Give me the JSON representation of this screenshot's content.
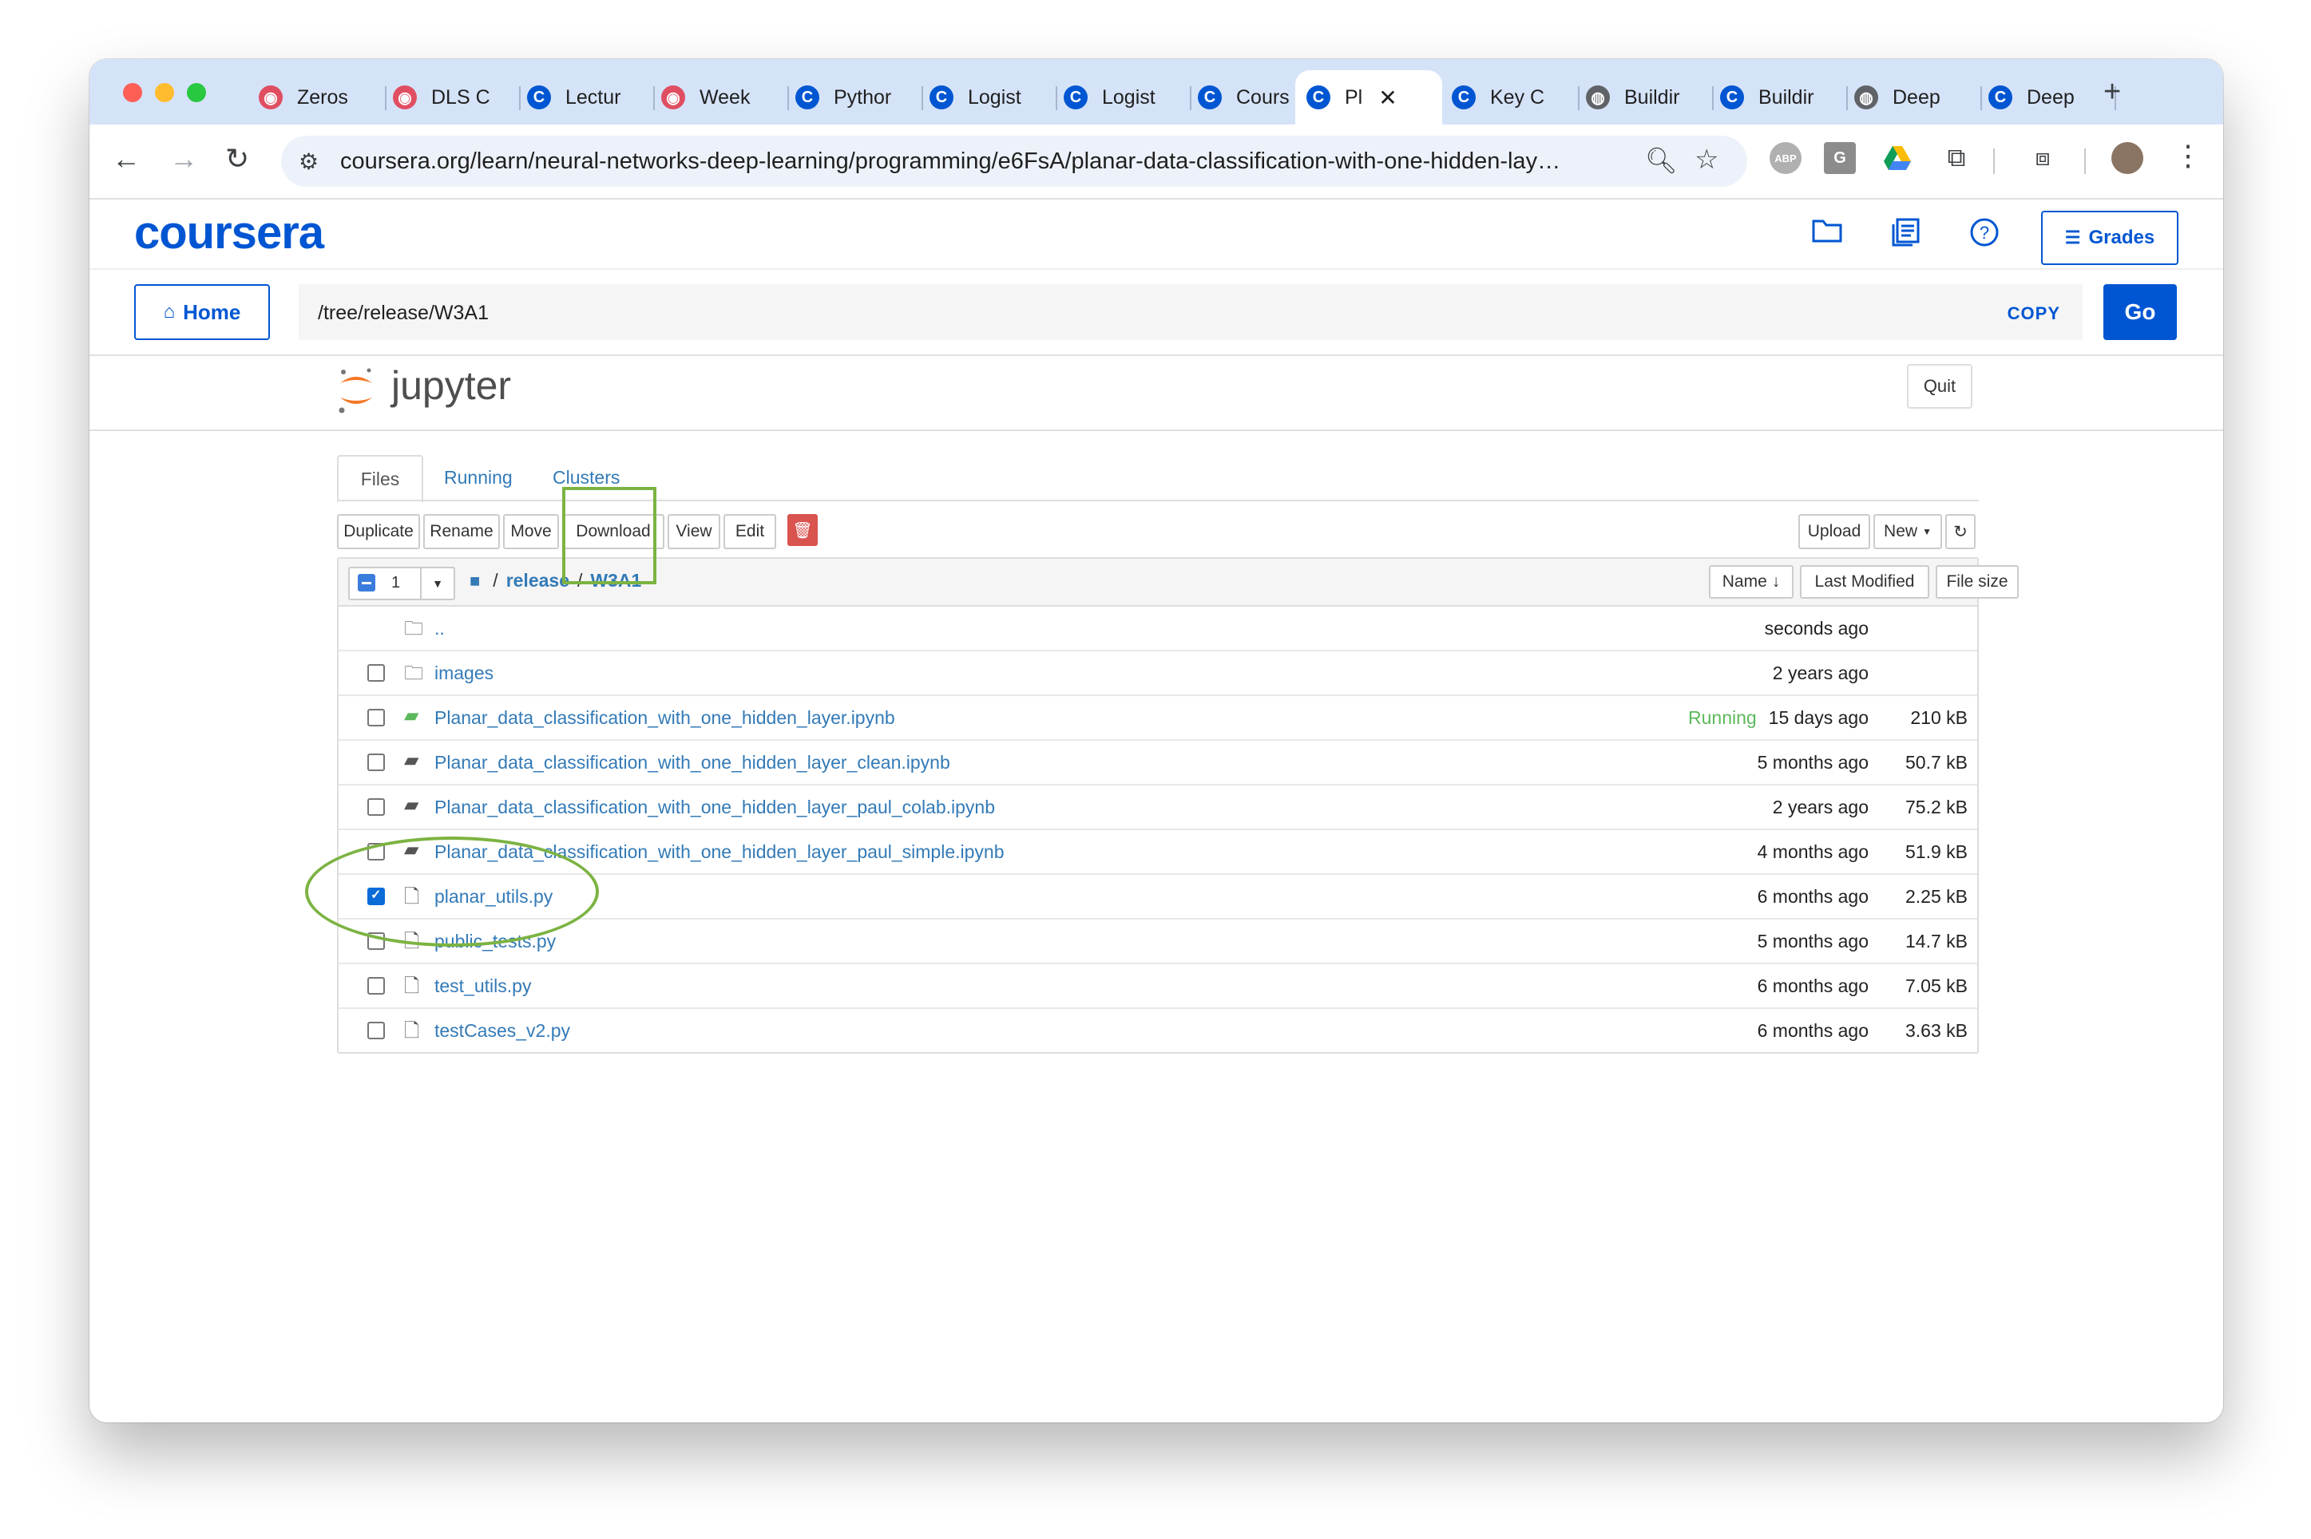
{
  "browser": {
    "tabs": [
      {
        "label": "Zeros",
        "icon": "deeplearning-icon"
      },
      {
        "label": "DLS C",
        "icon": "deeplearning-icon"
      },
      {
        "label": "Lectur",
        "icon": "coursera-icon"
      },
      {
        "label": "Week",
        "icon": "deeplearning-icon"
      },
      {
        "label": "Pythor",
        "icon": "coursera-icon"
      },
      {
        "label": "Logist",
        "icon": "coursera-icon"
      },
      {
        "label": "Logist",
        "icon": "coursera-icon"
      },
      {
        "label": "Cours",
        "icon": "coursera-icon"
      },
      {
        "label": "Pl",
        "icon": "coursera-icon",
        "active": true
      },
      {
        "label": "Key C",
        "icon": "coursera-icon"
      },
      {
        "label": "Buildir",
        "icon": "globe-icon"
      },
      {
        "label": "Buildir",
        "icon": "coursera-icon"
      },
      {
        "label": "Deep",
        "icon": "globe-icon"
      },
      {
        "label": "Deep",
        "icon": "coursera-icon"
      }
    ],
    "new_tab": "+",
    "close_tab": "✕",
    "url": "coursera.org/learn/neural-networks-deep-learning/programming/e6FsA/planar-data-classification-with-one-hidden-lay…",
    "ext_abp": "ABP",
    "ext_grammarly": "G"
  },
  "coursera": {
    "logo": "coursera",
    "grades_label": "Grades",
    "home_label": "Home",
    "path_value": "/tree/release/W3A1",
    "copy_label": "COPY",
    "go_label": "Go"
  },
  "jupyter": {
    "logo_text": "jupyter",
    "quit_label": "Quit",
    "tabs": {
      "files": "Files",
      "running": "Running",
      "clusters": "Clusters"
    },
    "actions": {
      "duplicate": "Duplicate",
      "rename": "Rename",
      "move": "Move",
      "download": "Download",
      "view": "View",
      "edit": "Edit"
    },
    "upload_label": "Upload",
    "new_label": "New",
    "selected_count": "1",
    "breadcrumb": {
      "root": "/",
      "release": "release",
      "w3a1": "W3A1"
    },
    "columns": {
      "name": "Name",
      "last_modified": "Last Modified",
      "file_size": "File size"
    },
    "files": [
      {
        "name": "..",
        "type": "folder",
        "modified": "seconds ago",
        "size": "",
        "status": "",
        "checkbox": false
      },
      {
        "name": "images",
        "type": "folder",
        "modified": "2 years ago",
        "size": "",
        "status": "",
        "checkbox": true
      },
      {
        "name": "Planar_data_classification_with_one_hidden_layer.ipynb",
        "type": "notebook-running",
        "modified": "15 days ago",
        "size": "210 kB",
        "status": "Running",
        "checkbox": true
      },
      {
        "name": "Planar_data_classification_with_one_hidden_layer_clean.ipynb",
        "type": "notebook",
        "modified": "5 months ago",
        "size": "50.7 kB",
        "status": "",
        "checkbox": true
      },
      {
        "name": "Planar_data_classification_with_one_hidden_layer_paul_colab.ipynb",
        "type": "notebook",
        "modified": "2 years ago",
        "size": "75.2 kB",
        "status": "",
        "checkbox": true
      },
      {
        "name": "Planar_data_classification_with_one_hidden_layer_paul_simple.ipynb",
        "type": "notebook",
        "modified": "4 months ago",
        "size": "51.9 kB",
        "status": "",
        "checkbox": true
      },
      {
        "name": "planar_utils.py",
        "type": "file",
        "modified": "6 months ago",
        "size": "2.25 kB",
        "status": "",
        "checkbox": true,
        "checked": true
      },
      {
        "name": "public_tests.py",
        "type": "file",
        "modified": "5 months ago",
        "size": "14.7 kB",
        "status": "",
        "checkbox": true
      },
      {
        "name": "test_utils.py",
        "type": "file",
        "modified": "6 months ago",
        "size": "7.05 kB",
        "status": "",
        "checkbox": true
      },
      {
        "name": "testCases_v2.py",
        "type": "file",
        "modified": "6 months ago",
        "size": "3.63 kB",
        "status": "",
        "checkbox": true
      }
    ]
  },
  "colors": {
    "coursera_blue": "#0056d2",
    "jupyter_link": "#337ab7",
    "running_green": "#5cb85c",
    "annotation_green": "#7cb342",
    "delete_red": "#d9534f"
  }
}
